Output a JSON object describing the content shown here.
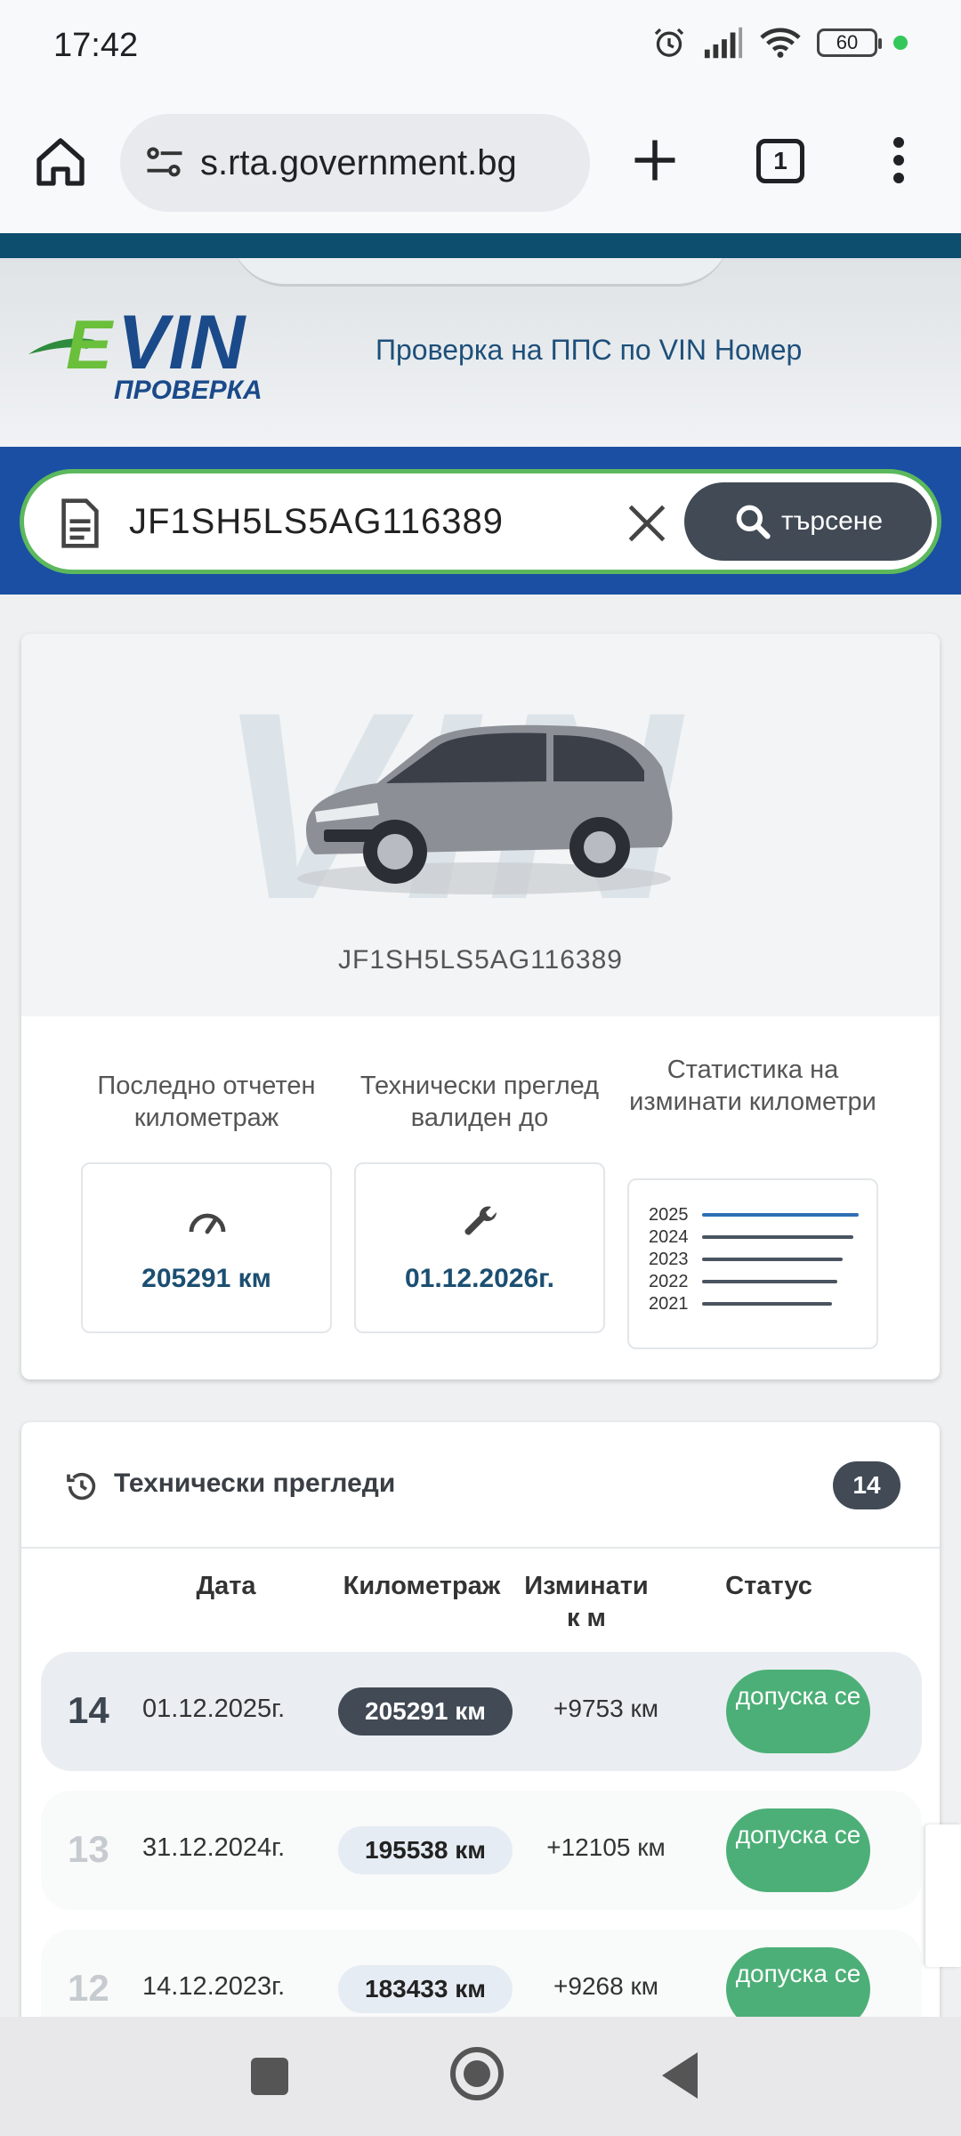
{
  "status_bar": {
    "time": "17:42",
    "battery": "60",
    "icons": [
      "alarm-icon",
      "signal-icon",
      "wifi-icon",
      "battery-icon"
    ]
  },
  "browser": {
    "url": "s.rta.government.bg",
    "tab_count": "1",
    "icons": [
      "home-icon",
      "site-settings-icon",
      "new-tab-icon",
      "tabs-icon",
      "more-menu-icon"
    ]
  },
  "site": {
    "logo_text": "eVIN",
    "logo_subtext": "ПРОВЕРКА",
    "tagline": "Проверка на ППС по VIN Номер",
    "brand_colors": {
      "header_band": "#1a4fa3",
      "accent_green": "#5cb85c",
      "dark_blue": "#0d4d6e"
    }
  },
  "search": {
    "value": "JF1SH5LS5AG116389",
    "button_label": "търсене"
  },
  "vehicle": {
    "vin": "JF1SH5LS5AG116389",
    "watermark": "VIN",
    "stats": {
      "mileage_title": "Последно отчетен километраж",
      "mileage_value": "205291 км",
      "inspection_title": "Технически преглед валиден до",
      "inspection_value": "01.12.2026г.",
      "statistics_title": "Статистика на изминати километри",
      "years": [
        "2025",
        "2024",
        "2023",
        "2022",
        "2021"
      ]
    }
  },
  "inspections": {
    "title": "Технически прегледи",
    "count": "14",
    "columns": [
      "Дата",
      "Километраж",
      "Изминати к м",
      "Статус"
    ],
    "rows": [
      {
        "num": "14",
        "date": "01.12.2025г.",
        "km": "205291 км",
        "diff": "+9753 км",
        "status": "допуска се"
      },
      {
        "num": "13",
        "date": "31.12.2024г.",
        "km": "195538 км",
        "diff": "+12105 км",
        "status": "допуска се"
      },
      {
        "num": "12",
        "date": "14.12.2023г.",
        "km": "183433 км",
        "diff": "+9268 км",
        "status": "допуска се"
      }
    ]
  }
}
